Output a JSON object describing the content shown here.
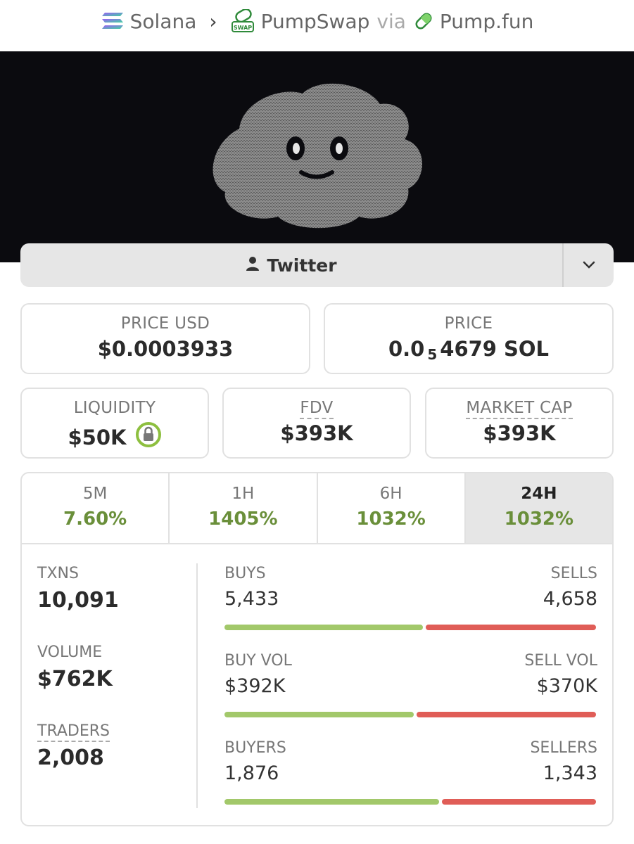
{
  "breadcrumb": {
    "chain": "Solana",
    "dex": "PumpSwap",
    "via": "via",
    "launchpad": "Pump.fun"
  },
  "socials": {
    "twitter_label": "Twitter"
  },
  "price_usd": {
    "label": "PRICE USD",
    "value": "$0.0003933"
  },
  "price_native": {
    "label": "PRICE",
    "prefix": "0.0",
    "zeros": "5",
    "digits": "4679",
    "unit": "SOL"
  },
  "liquidity": {
    "label": "LIQUIDITY",
    "value": "$50K"
  },
  "fdv": {
    "label": "FDV",
    "value": "$393K"
  },
  "market_cap": {
    "label": "MARKET CAP",
    "value": "$393K"
  },
  "timeframes": [
    {
      "label": "5M",
      "change": "7.60%"
    },
    {
      "label": "1H",
      "change": "1405%"
    },
    {
      "label": "6H",
      "change": "1032%"
    },
    {
      "label": "24H",
      "change": "1032%"
    }
  ],
  "stats": {
    "txns": {
      "label": "TXNS",
      "value": "10,091"
    },
    "volume": {
      "label": "VOLUME",
      "value": "$762K"
    },
    "traders": {
      "label": "TRADERS",
      "value": "2,008"
    }
  },
  "breakdown": {
    "buys": {
      "label": "BUYS",
      "value": "5,433"
    },
    "sells": {
      "label": "SELLS",
      "value": "4,658"
    },
    "buy_vol": {
      "label": "BUY VOL",
      "value": "$392K"
    },
    "sell_vol": {
      "label": "SELL VOL",
      "value": "$370K"
    },
    "buyers": {
      "label": "BUYERS",
      "value": "1,876"
    },
    "sellers": {
      "label": "SELLERS",
      "value": "1,343"
    }
  },
  "ratios": {
    "txns_buy_fraction": 0.538,
    "volume_buy_fraction": 0.514,
    "makers_buy_fraction": 0.583
  },
  "colors": {
    "positive": "#6a8f3a",
    "buy_bar": "#a2c86a",
    "sell_bar": "#e05d57",
    "liquidity_lock": "#8dbf3f"
  },
  "icons": {
    "chain": "solana-icon",
    "dex": "pumpswap-icon",
    "launchpad": "pill-icon",
    "twitter": "person-icon",
    "dropdown": "chevron-down-icon",
    "lock": "lock-icon"
  }
}
